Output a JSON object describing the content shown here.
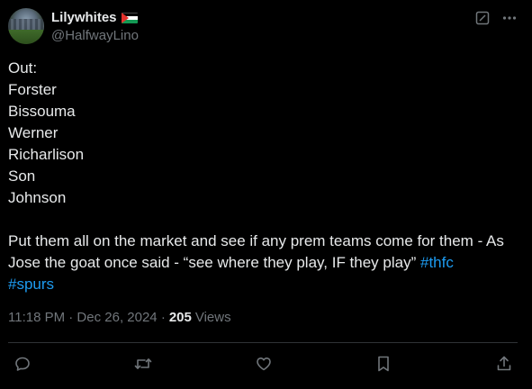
{
  "tweet": {
    "author": {
      "display_name": "Lilywhites",
      "handle": "@HalfwayLino"
    },
    "lines": [
      "Out:",
      "Forster",
      "Bissouma",
      "Werner",
      "Richarlison",
      "Son",
      "Johnson"
    ],
    "body_line1": "Put them all on the market and see if any prem teams come for them - As",
    "body_line2_text": "Jose the goat once said - “see where they play, IF they play” ",
    "hashtags": [
      "#thfc",
      "#spurs"
    ],
    "timestamp": "11:18 PM · Dec 26, 2024 ·",
    "views_count": "205",
    "views_label": "Views"
  },
  "icons": {
    "top": [
      "grok-icon",
      "more-icon"
    ],
    "actions": [
      "reply-icon",
      "retweet-icon",
      "like-icon",
      "bookmark-icon",
      "share-icon"
    ]
  },
  "colors": {
    "background": "#000000",
    "text": "#e7e9ea",
    "secondary_text": "#71767b",
    "link": "#1d9bf0",
    "divider": "#2f3336"
  }
}
